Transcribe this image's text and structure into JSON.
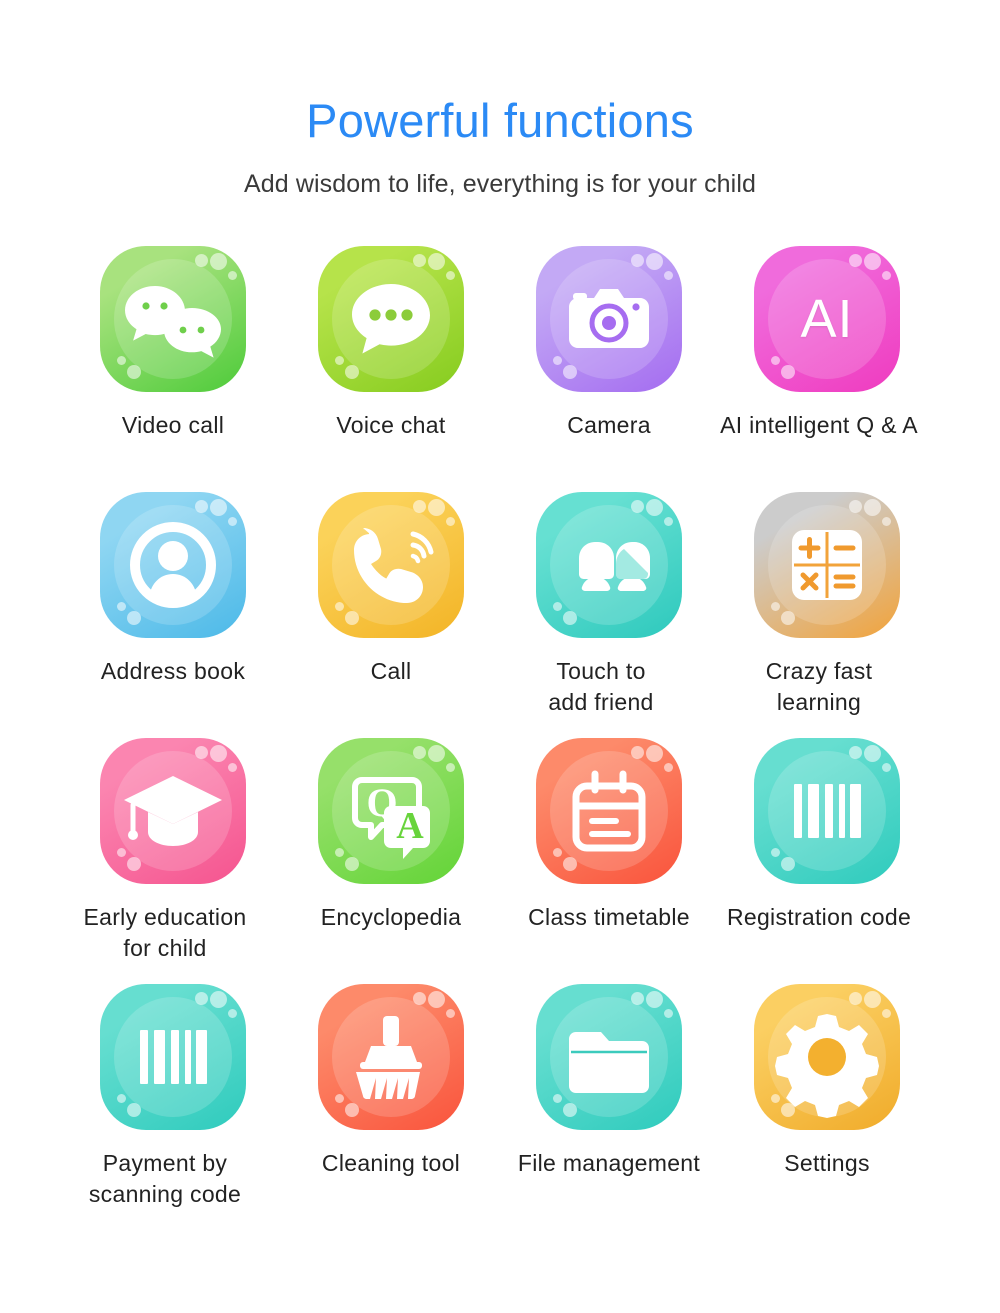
{
  "header": {
    "title": "Powerful functions",
    "subtitle": "Add wisdom to life, everything is for your child",
    "title_color": "#2b8af5",
    "subtitle_color": "#3a3a3a"
  },
  "grid": {
    "columns": 4,
    "rows": 4,
    "items": [
      {
        "label": "Video call",
        "icon": "chat-bubbles-icon",
        "color_from": "#a8e27e",
        "color_to": "#4ecb3a"
      },
      {
        "label": "Voice chat",
        "icon": "speech-bubble-dots-icon",
        "color_from": "#b6e34a",
        "color_to": "#86cc1f"
      },
      {
        "label": "Camera",
        "icon": "camera-icon",
        "color_from": "#c3a9f5",
        "color_to": "#a46cf0"
      },
      {
        "label": "AI intelligent Q & A",
        "icon": "ai-badge-icon",
        "color_from": "#f06bdc",
        "color_to": "#ef3bbf"
      },
      {
        "label": "Address book",
        "icon": "contact-person-icon",
        "color_from": "#8fd6f2",
        "color_to": "#4cb9e8"
      },
      {
        "label": "Call",
        "icon": "phone-handset-icon",
        "color_from": "#fbd259",
        "color_to": "#f3b426"
      },
      {
        "label": "Touch to\nadd friend",
        "icon": "two-people-icon",
        "color_from": "#66e0d2",
        "color_to": "#2ec9bd"
      },
      {
        "label": "Crazy fast\nlearning",
        "icon": "calculator-icon",
        "color_from": "#fcc濃",
        "color_to": "#f2a33a"
      },
      {
        "label": "Early education\nfor child",
        "icon": "graduation-cap-icon",
        "color_from": "#fb85b0",
        "color_to": "#f5548f"
      },
      {
        "label": "Encyclopedia",
        "icon": "qa-bubbles-icon",
        "color_from": "#96e06a",
        "color_to": "#63d437"
      },
      {
        "label": "Class timetable",
        "icon": "calendar-notepad-icon",
        "color_from": "#fd8a6a",
        "color_to": "#f9543c"
      },
      {
        "label": "Registration code",
        "icon": "barcode-icon",
        "color_from": "#66ded0",
        "color_to": "#2fcbbd"
      },
      {
        "label": "Payment by\nscanning code",
        "icon": "barcode-icon",
        "color_from": "#66ded0",
        "color_to": "#2fcbbd"
      },
      {
        "label": "Cleaning tool",
        "icon": "broom-brush-icon",
        "color_from": "#fd8a6a",
        "color_to": "#f9543c"
      },
      {
        "label": "File management",
        "icon": "folder-icon",
        "color_from": "#66ded0",
        "color_to": "#2fcbbd"
      },
      {
        "label": "Settings",
        "icon": "gear-icon",
        "color_from": "#fbcf62",
        "color_to": "#f0ab2a"
      }
    ]
  },
  "icon_glyph_text": {
    "ai": "AI",
    "question": "Q",
    "answer": "A"
  }
}
